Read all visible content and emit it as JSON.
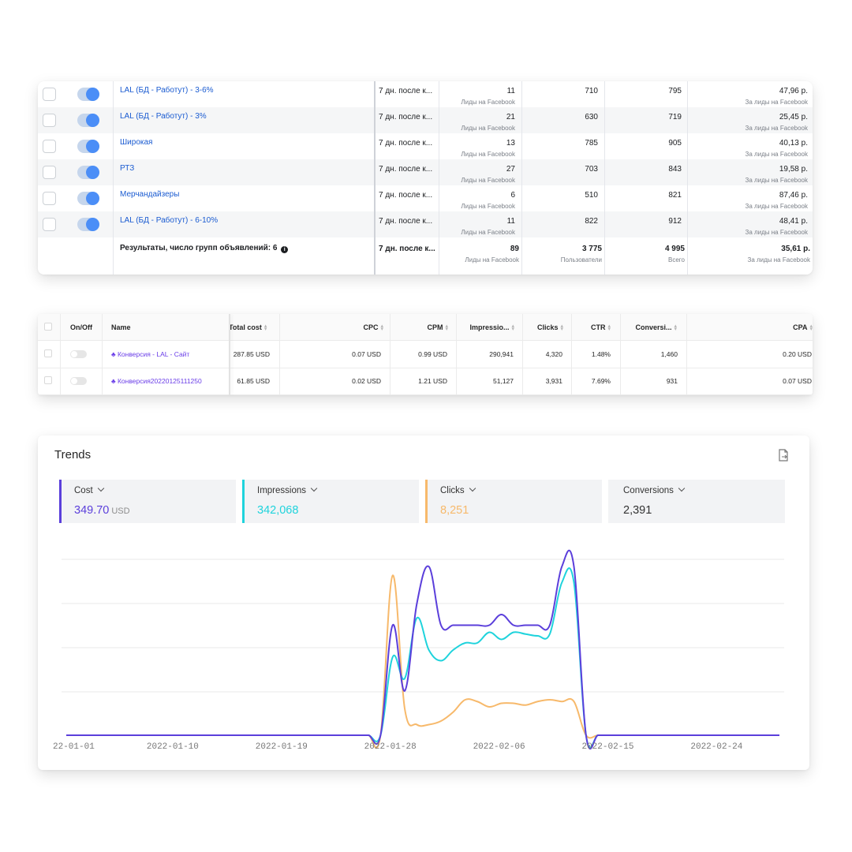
{
  "facebook_adsets": {
    "rows": [
      {
        "name": "LAL (БД - Работут) - 3-6%",
        "attribution": "7 дн. после к...",
        "results": "11",
        "results_sub": "Лиды на Facebook",
        "reach": "710",
        "impressions": "795",
        "cost": "47,96 р.",
        "cost_sub": "За лиды на Facebook",
        "enabled": true
      },
      {
        "name": "LAL (БД - Работут) - 3%",
        "attribution": "7 дн. после к...",
        "results": "21",
        "results_sub": "Лиды на Facebook",
        "reach": "630",
        "impressions": "719",
        "cost": "25,45 р.",
        "cost_sub": "За лиды на Facebook",
        "enabled": true
      },
      {
        "name": "Широкая",
        "attribution": "7 дн. после к...",
        "results": "13",
        "results_sub": "Лиды на Facebook",
        "reach": "785",
        "impressions": "905",
        "cost": "40,13 р.",
        "cost_sub": "За лиды на Facebook",
        "enabled": true
      },
      {
        "name": "РТЗ",
        "attribution": "7 дн. после к...",
        "results": "27",
        "results_sub": "Лиды на Facebook",
        "reach": "703",
        "impressions": "843",
        "cost": "19,58 р.",
        "cost_sub": "За лиды на Facebook",
        "enabled": true
      },
      {
        "name": "Мерчандайзеры",
        "attribution": "7 дн. после к...",
        "results": "6",
        "results_sub": "Лиды на Facebook",
        "reach": "510",
        "impressions": "821",
        "cost": "87,46 р.",
        "cost_sub": "За лиды на Facebook",
        "enabled": true
      },
      {
        "name": "LAL (БД - Работут) - 6-10%",
        "attribution": "7 дн. после к...",
        "results": "11",
        "results_sub": "Лиды на Facebook",
        "reach": "822",
        "impressions": "912",
        "cost": "48,41 р.",
        "cost_sub": "За лиды на Facebook",
        "enabled": true
      }
    ],
    "total": {
      "label": "Результаты, число групп объявлений: 6",
      "attribution": "7 дн. после к...",
      "results": "89",
      "results_sub": "Лиды на Facebook",
      "reach": "3 775",
      "reach_sub": "Пользователи",
      "impressions": "4 995",
      "impressions_sub": "Всего",
      "cost": "35,61 р.",
      "cost_sub": "За лиды на Facebook"
    }
  },
  "campaign_table": {
    "headers": {
      "onoff": "On/Off",
      "name": "Name",
      "total_cost": "Total cost",
      "cpc": "CPC",
      "cpm": "CPM",
      "impressions": "Impressio...",
      "clicks": "Clicks",
      "ctr": "CTR",
      "conversions": "Conversi...",
      "cpa": "CPA"
    },
    "rows": [
      {
        "name": "Конверсия - LAL - Сайт",
        "total_cost": "287.85 USD",
        "cpc": "0.07 USD",
        "cpm": "0.99 USD",
        "impressions": "290,941",
        "clicks": "4,320",
        "ctr": "1.48%",
        "conversions": "1,460",
        "cpa": "0.20 USD",
        "enabled": false
      },
      {
        "name": "Конверсия20220125111250",
        "total_cost": "61.85 USD",
        "cpc": "0.02 USD",
        "cpm": "1.21 USD",
        "impressions": "51,127",
        "clicks": "3,931",
        "ctr": "7.69%",
        "conversions": "931",
        "cpa": "0.07 USD",
        "enabled": false
      }
    ]
  },
  "trends": {
    "title": "Trends",
    "export_icon": "file-export-icon",
    "kpis": [
      {
        "label": "Cost",
        "value": "349.70",
        "unit": "USD",
        "color": "#5b3fdb"
      },
      {
        "label": "Impressions",
        "value": "342,068",
        "unit": "",
        "color": "#1fd3dc"
      },
      {
        "label": "Clicks",
        "value": "8,251",
        "unit": "",
        "color": "#f7b96b"
      },
      {
        "label": "Conversions",
        "value": "2,391",
        "unit": "",
        "color": "#444444"
      }
    ]
  },
  "chart_data": {
    "type": "line",
    "title": "",
    "xlabel": "",
    "ylabel": "",
    "grid": true,
    "x_tick_labels": [
      "22-01-01",
      "2022-01-10",
      "2022-01-19",
      "2022-01-28",
      "2022-02-06",
      "2022-02-15",
      "2022-02-24"
    ],
    "x": [
      "2022-01-01",
      "2022-01-02",
      "2022-01-03",
      "2022-01-04",
      "2022-01-05",
      "2022-01-06",
      "2022-01-07",
      "2022-01-08",
      "2022-01-09",
      "2022-01-10",
      "2022-01-11",
      "2022-01-12",
      "2022-01-13",
      "2022-01-14",
      "2022-01-15",
      "2022-01-16",
      "2022-01-17",
      "2022-01-18",
      "2022-01-19",
      "2022-01-20",
      "2022-01-21",
      "2022-01-22",
      "2022-01-23",
      "2022-01-24",
      "2022-01-25",
      "2022-01-26",
      "2022-01-27",
      "2022-01-28",
      "2022-01-29",
      "2022-01-30",
      "2022-01-31",
      "2022-02-01",
      "2022-02-02",
      "2022-02-03",
      "2022-02-04",
      "2022-02-05",
      "2022-02-06",
      "2022-02-07",
      "2022-02-08",
      "2022-02-09",
      "2022-02-10",
      "2022-02-11",
      "2022-02-12",
      "2022-02-13",
      "2022-02-14",
      "2022-02-15",
      "2022-02-16",
      "2022-02-17",
      "2022-02-18",
      "2022-02-19",
      "2022-02-20",
      "2022-02-21",
      "2022-02-22",
      "2022-02-23",
      "2022-02-24",
      "2022-02-25",
      "2022-02-26",
      "2022-02-27",
      "2022-02-28",
      "2022-03-01"
    ],
    "series": [
      {
        "name": "Cost",
        "color": "#5b3fdb",
        "values": [
          0,
          0,
          0,
          0,
          0,
          0,
          0,
          0,
          0,
          0,
          0,
          0,
          0,
          0,
          0,
          0,
          0,
          0,
          0,
          0,
          0,
          0,
          0,
          0,
          0,
          0,
          0.0,
          0.62,
          0.25,
          0.74,
          0.95,
          0.62,
          0.62,
          0.62,
          0.62,
          0.62,
          0.68,
          0.62,
          0.62,
          0.62,
          0.62,
          0.95,
          0.95,
          0.0,
          0,
          0,
          0,
          0,
          0,
          0,
          0,
          0,
          0,
          0,
          0,
          0,
          0,
          0,
          0,
          0
        ]
      },
      {
        "name": "Impressions",
        "color": "#1fd3dc",
        "values": [
          0,
          0,
          0,
          0,
          0,
          0,
          0,
          0,
          0,
          0,
          0,
          0,
          0,
          0,
          0,
          0,
          0,
          0,
          0,
          0,
          0,
          0,
          0,
          0,
          0,
          0,
          0.0,
          0.44,
          0.32,
          0.66,
          0.48,
          0.42,
          0.48,
          0.52,
          0.52,
          0.58,
          0.54,
          0.58,
          0.57,
          0.56,
          0.57,
          0.86,
          0.86,
          0.0,
          0,
          0,
          0,
          0,
          0,
          0,
          0,
          0,
          0,
          0,
          0,
          0,
          0,
          0,
          0,
          0
        ]
      },
      {
        "name": "Clicks",
        "color": "#f7b96b",
        "values": [
          0,
          0,
          0,
          0,
          0,
          0,
          0,
          0,
          0,
          0,
          0,
          0,
          0,
          0,
          0,
          0,
          0,
          0,
          0,
          0,
          0,
          0,
          0,
          0,
          0,
          0,
          0.0,
          0.9,
          0.15,
          0.06,
          0.06,
          0.08,
          0.13,
          0.2,
          0.19,
          0.16,
          0.18,
          0.18,
          0.17,
          0.19,
          0.2,
          0.19,
          0.19,
          0.0,
          0,
          0,
          0,
          0,
          0,
          0,
          0,
          0,
          0,
          0,
          0,
          0,
          0,
          0,
          0,
          0
        ]
      }
    ],
    "y_relative": true
  }
}
